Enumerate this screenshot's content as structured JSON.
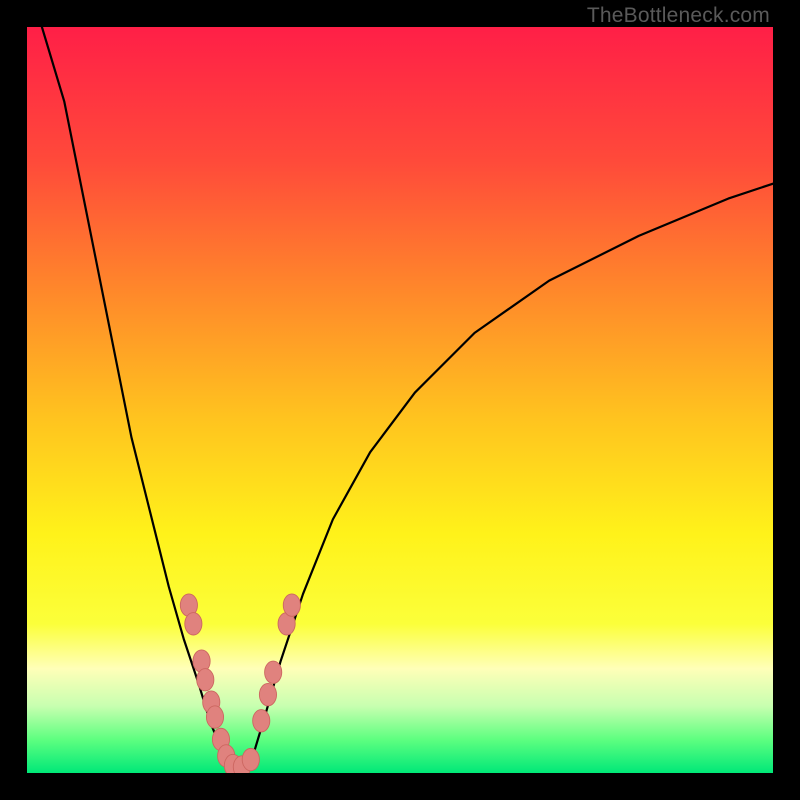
{
  "watermark": "TheBottleneck.com",
  "colors": {
    "black": "#000000",
    "curve_stroke": "#000000",
    "bead_fill": "#e0827e",
    "bead_stroke": "#cc6660",
    "gradient_stops": [
      {
        "offset": 0.0,
        "color": "#ff1f47"
      },
      {
        "offset": 0.18,
        "color": "#ff4a3a"
      },
      {
        "offset": 0.36,
        "color": "#ff8a2a"
      },
      {
        "offset": 0.52,
        "color": "#ffc21f"
      },
      {
        "offset": 0.68,
        "color": "#fff21a"
      },
      {
        "offset": 0.8,
        "color": "#fbff3a"
      },
      {
        "offset": 0.86,
        "color": "#ffffb8"
      },
      {
        "offset": 0.91,
        "color": "#c8ffb0"
      },
      {
        "offset": 0.955,
        "color": "#5eff80"
      },
      {
        "offset": 1.0,
        "color": "#00e878"
      }
    ]
  },
  "chart_data": {
    "type": "line",
    "title": "",
    "xlabel": "",
    "ylabel": "",
    "xlim": [
      0,
      100
    ],
    "ylim": [
      0,
      100
    ],
    "series": [
      {
        "name": "left-arm",
        "x": [
          2,
          5,
          8,
          11,
          14,
          17,
          19,
          21,
          23,
          24.5,
          25.7,
          26.5,
          27
        ],
        "y": [
          100,
          90,
          75,
          60,
          45,
          33,
          25,
          18,
          12,
          7,
          4,
          2,
          0.5
        ]
      },
      {
        "name": "right-arm",
        "x": [
          29.5,
          30.5,
          32,
          34,
          37,
          41,
          46,
          52,
          60,
          70,
          82,
          94,
          100
        ],
        "y": [
          0.5,
          3,
          8,
          15,
          24,
          34,
          43,
          51,
          59,
          66,
          72,
          77,
          79
        ]
      },
      {
        "name": "valley-floor",
        "x": [
          27,
          28.2,
          29.5
        ],
        "y": [
          0.5,
          0.2,
          0.5
        ]
      }
    ],
    "beads_left": [
      {
        "x": 21.7,
        "y": 22.5
      },
      {
        "x": 22.3,
        "y": 20.0
      },
      {
        "x": 23.4,
        "y": 15.0
      },
      {
        "x": 23.9,
        "y": 12.5
      },
      {
        "x": 24.7,
        "y": 9.5
      },
      {
        "x": 25.2,
        "y": 7.5
      },
      {
        "x": 26.0,
        "y": 4.5
      },
      {
        "x": 26.7,
        "y": 2.3
      }
    ],
    "beads_right": [
      {
        "x": 31.4,
        "y": 7.0
      },
      {
        "x": 32.3,
        "y": 10.5
      },
      {
        "x": 33.0,
        "y": 13.5
      },
      {
        "x": 34.8,
        "y": 20.0
      },
      {
        "x": 35.5,
        "y": 22.5
      }
    ],
    "beads_bottom": [
      {
        "x": 27.6,
        "y": 1.0
      },
      {
        "x": 28.8,
        "y": 0.8
      },
      {
        "x": 30.0,
        "y": 1.8
      }
    ],
    "bead_rx": 1.15,
    "bead_ry": 1.5
  }
}
